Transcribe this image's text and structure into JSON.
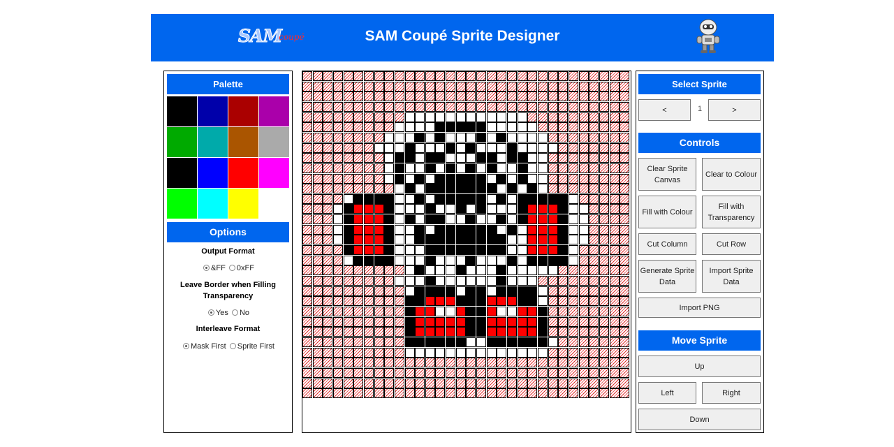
{
  "header": {
    "title": "SAM Coupé Sprite Designer",
    "logo": {
      "main": "SAM",
      "sub": "coupé"
    }
  },
  "palette": {
    "title": "Palette",
    "colors": [
      "#000000",
      "#0000aa",
      "#aa0000",
      "#aa00aa",
      "#00aa00",
      "#00aaaa",
      "#aa5500",
      "#aaaaaa",
      "#000000",
      "#0000ff",
      "#ff0000",
      "#ff00ff",
      "#00ff00",
      "#00ffff",
      "#ffff00",
      "#ffffff"
    ]
  },
  "options": {
    "title": "Options",
    "output_format": {
      "label": "Output Format",
      "choices": [
        "&FF",
        "0xFF"
      ],
      "selected": "&FF"
    },
    "leave_border": {
      "label": "Leave Border when Filling Transparency",
      "choices": [
        "Yes",
        "No"
      ],
      "selected": "Yes"
    },
    "interleave": {
      "label": "Interleave Format",
      "choices": [
        "Mask First",
        "Sprite First"
      ],
      "selected": "Mask First"
    }
  },
  "canvas": {
    "rows": [
      "................................",
      "................................",
      "................................",
      "................................",
      "..........WWWWWWWWWWWW..........",
      ".........WWWWKKKKKWWWWW.........",
      "........WWWKWKWWWKWKWWWW........",
      ".......WWWKWWWKWKWWWKWWWW.......",
      "........WKKWKKWWWKKWKKWW........",
      "........WKWWKWKWKWKWWKWW........",
      "........WKWKWKKKKKWKWKWW........",
      ".........WKWKKKKKKKWKWKW........",
      "....WKKKKWWKWKKKKKWKWKKKKKW.....",
      "...WKRRRKWWWKWWKWKWWWKRRRKWW....",
      "...WKRRRKWKWKKWWKWWKWKRRRKWW....",
      "...WKRRRKWWKWKKKKKKWKWRRRKWW....",
      "...WKRRRKWWKKKKKKKKKWWRRRKWW....",
      "....KRRRKWWWKKKKKKKKWWRRRKW.....",
      "....WKKKKWWWKWWWKWWWKWKKKKW.....",
      "..........WKWWWKWWWKWWWWW.......",
      ".........WWWKWWWWWWKWWW.........",
      "..........WKKKKWKKWKKKKW........",
      "..........KKRRRKKKRRRKKW........",
      "..........KRRWWRKKRWWRRK........",
      "..........KRRRRRKKRRRRRK........",
      "..........KRRRRRKKRRRRRK........",
      "..........KKKKKKWWKKKKKKW.......",
      "..........WWWWWWWWWWWWWW........",
      "................................",
      "................................",
      "................................",
      "................................"
    ],
    "palette_map": {
      ".": "transparent",
      "W": "#ffffff",
      "K": "#000000",
      "R": "#ff0000"
    }
  },
  "select_sprite": {
    "title": "Select Sprite",
    "prev": "<",
    "next": ">",
    "current": "1"
  },
  "controls": {
    "title": "Controls",
    "clear_canvas": "Clear Sprite Canvas",
    "clear_colour": "Clear to Colour",
    "fill_colour": "Fill with Colour",
    "fill_transparency": "Fill with Transparency",
    "cut_column": "Cut Column",
    "cut_row": "Cut Row",
    "generate": "Generate Sprite Data",
    "import_data": "Import Sprite Data",
    "import_png": "Import PNG"
  },
  "move": {
    "title": "Move Sprite",
    "up": "Up",
    "left": "Left",
    "right": "Right",
    "down": "Down"
  }
}
